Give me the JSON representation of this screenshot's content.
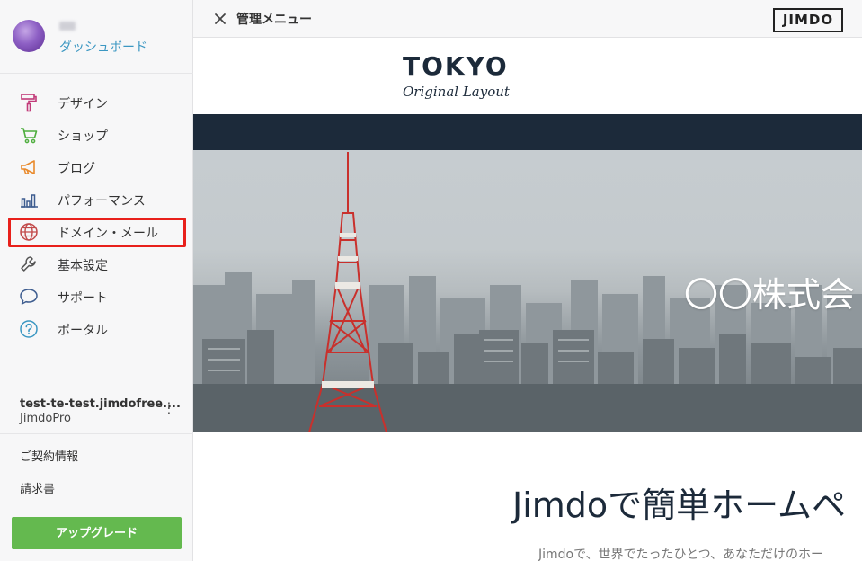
{
  "profile": {
    "dashboard_label": "ダッシュボード"
  },
  "nav": {
    "items": [
      {
        "label": "デザイン",
        "icon": "paint-roller-icon"
      },
      {
        "label": "ショップ",
        "icon": "cart-icon"
      },
      {
        "label": "ブログ",
        "icon": "megaphone-icon"
      },
      {
        "label": "パフォーマンス",
        "icon": "bar-chart-icon"
      },
      {
        "label": "ドメイン・メール",
        "icon": "globe-icon"
      },
      {
        "label": "基本設定",
        "icon": "wrench-icon"
      },
      {
        "label": "サポート",
        "icon": "speech-bubble-icon"
      },
      {
        "label": "ポータル",
        "icon": "question-icon"
      }
    ],
    "highlighted_index": 4
  },
  "site": {
    "name": "test-te-test.jimdofree....",
    "plan": "JimdoPro",
    "menu_icon": "⋮"
  },
  "links": {
    "contract": "ご契約情報",
    "invoice": "請求書"
  },
  "upgrade_label": "アップグレード",
  "topbar": {
    "close_icon": "×",
    "title": "管理メニュー",
    "logo": "JIMDO"
  },
  "preview": {
    "logo_main": "TOKYO",
    "logo_sub": "Original Layout",
    "hero_text": "〇〇株式会",
    "heading": "Jimdoで簡単ホームペ",
    "subtext": "Jimdoで、世界でたったひとつ、あなただけのホー"
  },
  "colors": {
    "accent_blue": "#3b97c2",
    "upgrade_green": "#64b94f",
    "highlight_red": "#e8201b",
    "navy": "#1c2a3a"
  }
}
